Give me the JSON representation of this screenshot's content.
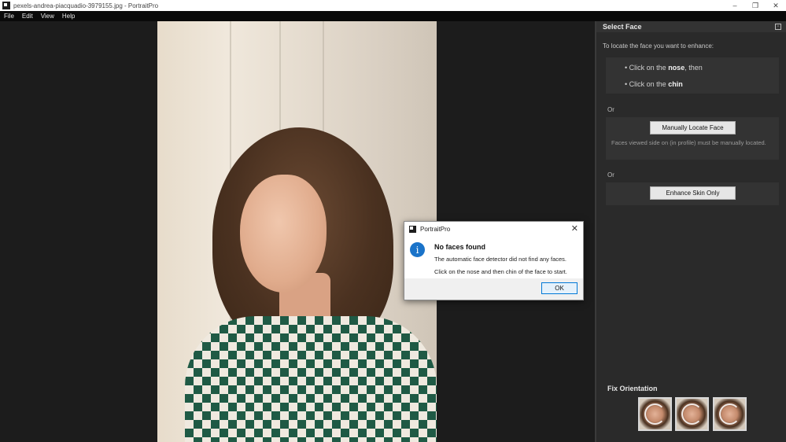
{
  "window": {
    "title": "pexels-andrea-piacquadio-3979155.jpg - PortraitPro",
    "controls": [
      "–",
      "❐",
      "✕"
    ]
  },
  "menu": [
    "File",
    "Edit",
    "View",
    "Help"
  ],
  "panel": {
    "title": "Select Face",
    "instruction": "To locate the face you want to enhance:",
    "step1_pre": "Click on the ",
    "step1_bold": "nose",
    "step1_post": ", then",
    "step2_pre": "Click on the ",
    "step2_bold": "chin",
    "or1": "Or",
    "locate_button": "Manually Locate Face",
    "profile_note": "Faces viewed side on (in profile) must be manually located.",
    "or2": "Or",
    "skin_button": "Enhance Skin Only",
    "fix_orientation_label": "Fix Orientation"
  },
  "dialog": {
    "title": "PortraitPro",
    "heading": "No faces found",
    "message1": "The automatic face detector did not find any faces.",
    "message2": "Click on the nose and then chin of the face to start.",
    "ok": "OK",
    "close": "✕",
    "info_glyph": "i"
  }
}
